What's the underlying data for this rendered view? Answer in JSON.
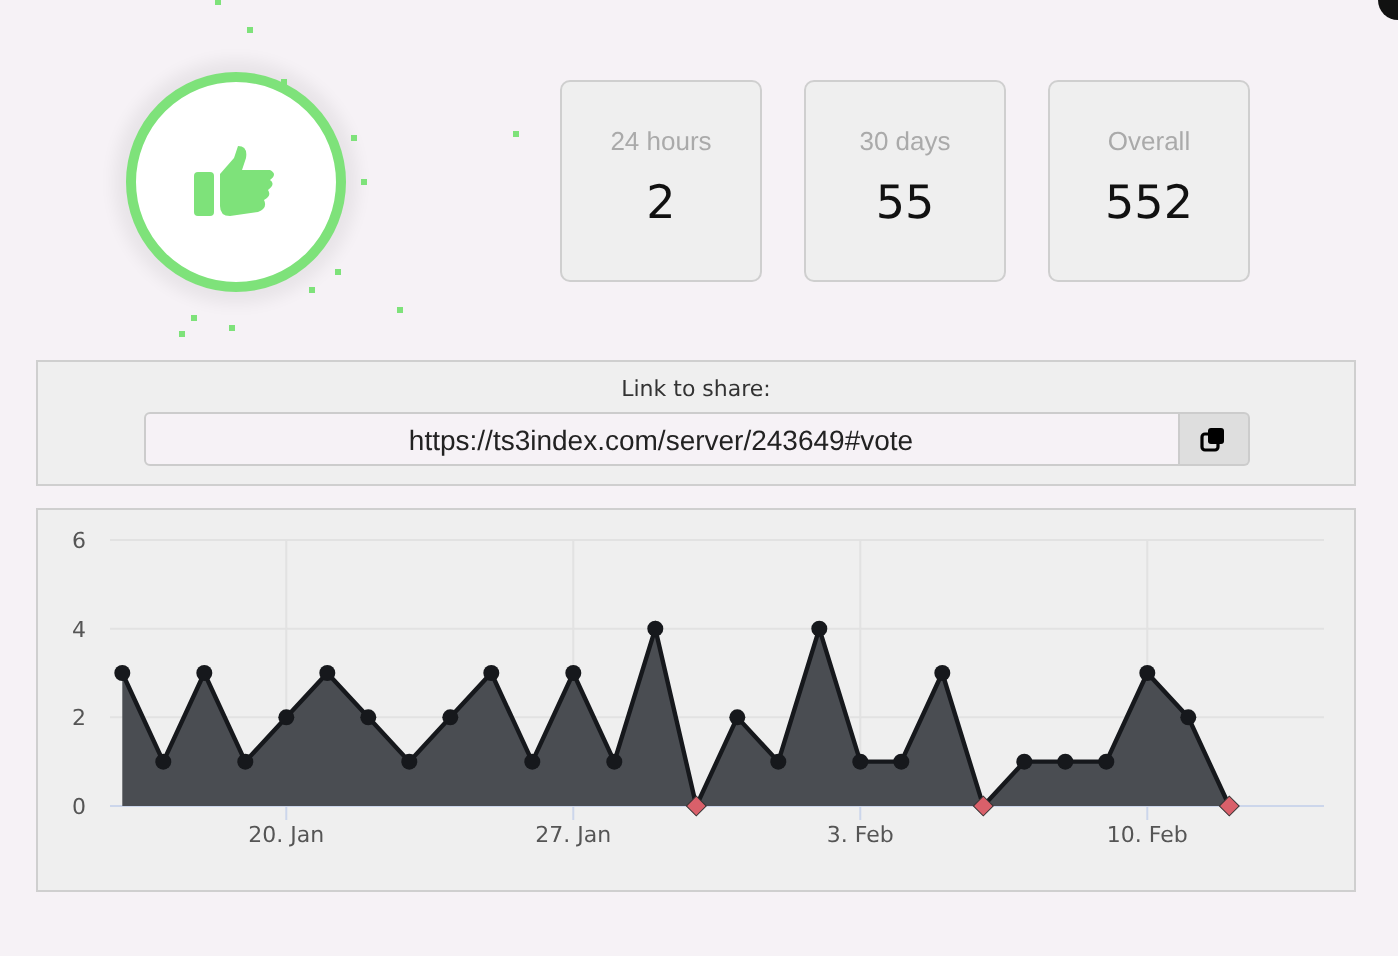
{
  "badge": {
    "kind": "thumbs-up"
  },
  "stats": [
    {
      "label": "24 hours",
      "value": "2"
    },
    {
      "label": "30 days",
      "value": "55"
    },
    {
      "label": "Overall",
      "value": "552"
    }
  ],
  "share": {
    "label": "Link to share:",
    "value": "https://ts3index.com/server/243649#vote"
  },
  "chart": {
    "chart_data": {
      "type": "area",
      "categories": [
        null,
        null,
        null,
        null,
        "20. Jan",
        null,
        null,
        null,
        null,
        null,
        null,
        "27. Jan",
        null,
        null,
        null,
        null,
        null,
        null,
        "3. Feb",
        null,
        null,
        null,
        null,
        null,
        null,
        "10. Feb",
        null,
        null
      ],
      "series": [
        {
          "color": "#4a4d52",
          "values": [
            3,
            1,
            3,
            1,
            2,
            3,
            2,
            1,
            2,
            3,
            1,
            3,
            1,
            4,
            0,
            2,
            1,
            4,
            1,
            1,
            3,
            0,
            1,
            1,
            1,
            3,
            2,
            0
          ]
        }
      ],
      "grid": true,
      "ylim": [
        0,
        6
      ],
      "yticks": [
        0,
        2,
        4,
        6
      ]
    }
  }
}
